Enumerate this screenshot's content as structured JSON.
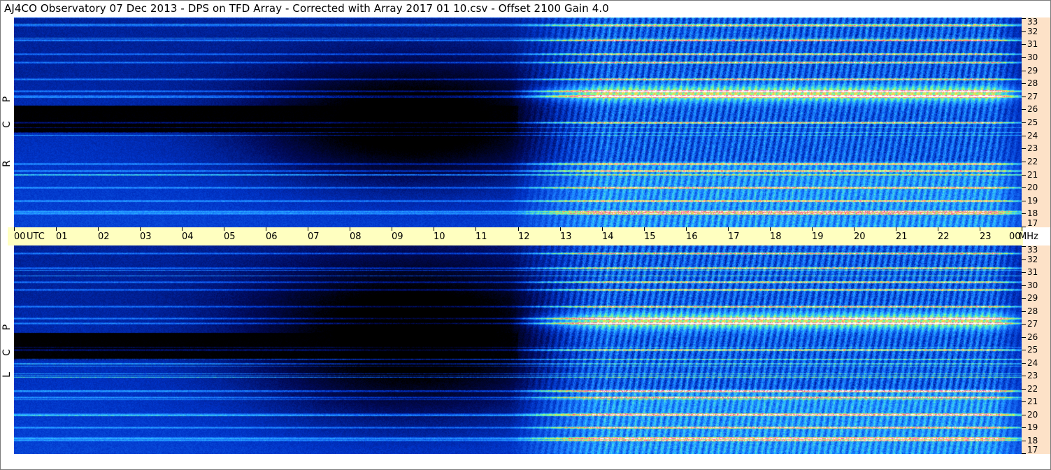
{
  "title": "AJ4CO Observatory  07 Dec 2013  -  DPS on TFD Array  -  Corrected with Array 2017 01 10.csv  -  Offset 2100  Gain 4.0",
  "chart_data": [
    {
      "type": "heatmap",
      "panel": "RCP",
      "side_label": [
        "R",
        "C",
        "P"
      ],
      "x_unit_label": "UTC",
      "x_ticks": [
        "00",
        "01",
        "02",
        "03",
        "04",
        "05",
        "06",
        "07",
        "08",
        "09",
        "10",
        "11",
        "12",
        "13",
        "14",
        "15",
        "16",
        "17",
        "18",
        "19",
        "20",
        "21",
        "22",
        "23",
        "00"
      ],
      "y_unit_label": "MHz",
      "y_ticks": [
        33,
        32,
        31,
        30,
        29,
        28,
        27,
        26,
        25,
        24,
        23,
        22,
        21,
        20,
        19,
        18,
        17
      ],
      "ylim": [
        17,
        33
      ],
      "colormap": [
        "#000000",
        "#000a5a",
        "#0033c8",
        "#1a7aff",
        "#30c8ff",
        "#7cff90",
        "#ffe040",
        "#ff40a0",
        "#ffffff"
      ]
    },
    {
      "type": "heatmap",
      "panel": "LCP",
      "side_label": [
        "L",
        "C",
        "P"
      ],
      "x_unit_label": "UTC",
      "x_ticks": [
        "00",
        "01",
        "02",
        "03",
        "04",
        "05",
        "06",
        "07",
        "08",
        "09",
        "10",
        "11",
        "12",
        "13",
        "14",
        "15",
        "16",
        "17",
        "18",
        "19",
        "20",
        "21",
        "22",
        "23",
        "00"
      ],
      "y_unit_label": "MHz",
      "y_ticks": [
        33,
        32,
        31,
        30,
        29,
        28,
        27,
        26,
        25,
        24,
        23,
        22,
        21,
        20,
        19,
        18,
        17
      ],
      "ylim": [
        17,
        33
      ],
      "colormap": [
        "#000000",
        "#000a5a",
        "#0033c8",
        "#1a7aff",
        "#30c8ff",
        "#7cff90",
        "#ffe040",
        "#ff40a0",
        "#ffffff"
      ]
    }
  ]
}
